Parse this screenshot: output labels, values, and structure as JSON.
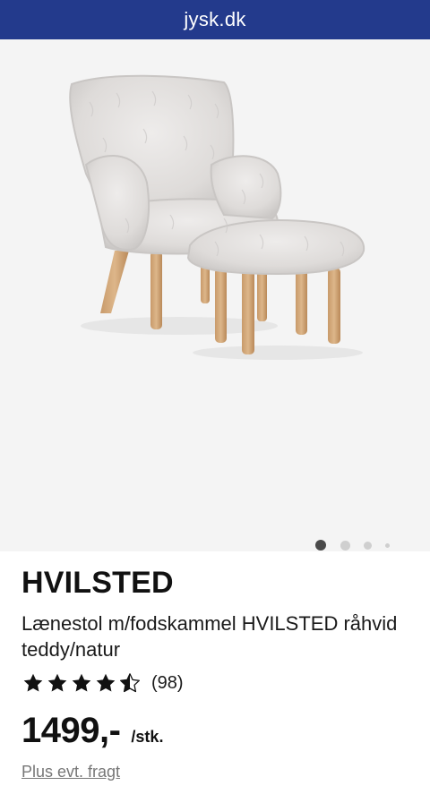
{
  "browser": {
    "url": "jysk.dk"
  },
  "gallery": {
    "image_alt": "Lænestol m/fodskammel HVILSTED råhvid teddy/natur",
    "dots_total": 4,
    "active_dot": 1
  },
  "product": {
    "brand": "HVILSTED",
    "description": "Lænestol m/fodskammel HVILSTED råhvid teddy/natur",
    "rating": 4.5,
    "rating_count": "(98)",
    "price": "1499,-",
    "unit": "/stk.",
    "shipping_link": "Plus evt. fragt"
  },
  "colors": {
    "topbar": "#233a8c",
    "gallery_bg": "#f4f4f4"
  }
}
